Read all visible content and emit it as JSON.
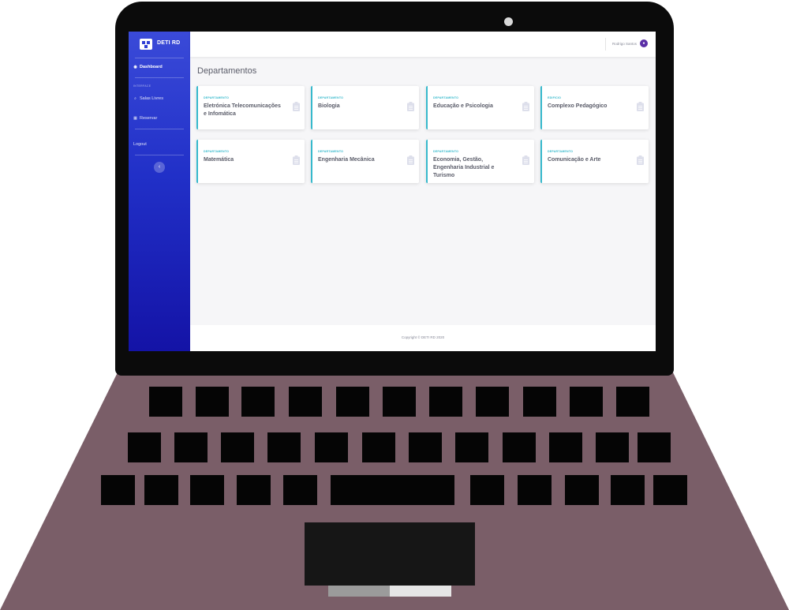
{
  "colors": {
    "sidebar_top": "#3a4ad8",
    "sidebar_bottom": "#1413a6",
    "card_accent": "#36b9cc",
    "laptop_body": "#7a5e68"
  },
  "brand": {
    "name": "DETI RD"
  },
  "sidebar": {
    "dashboard_label": "Dashboard",
    "section_heading": "INTERFACE",
    "items": [
      {
        "label": "Salas Livres",
        "icon": "search-icon"
      },
      {
        "label": "Reservar",
        "icon": "calendar-icon"
      }
    ],
    "logout_label": "Logout",
    "collapse_glyph": "‹"
  },
  "topbar": {
    "user_name": "Rodrigo Santos",
    "avatar_glyph": "●"
  },
  "main": {
    "title": "Departamentos",
    "cards": [
      {
        "label": "DEPARTAMENTO",
        "title": "Eletrónica Telecomunicações e Infomática"
      },
      {
        "label": "DEPARTAMENTO",
        "title": "Biologia"
      },
      {
        "label": "DEPARTAMENTO",
        "title": "Educação e Psicologia"
      },
      {
        "label": "EDIFICIO",
        "title": "Complexo Pedagógico"
      },
      {
        "label": "DEPARTAMENTO",
        "title": "Matemática"
      },
      {
        "label": "DEPARTAMENTO",
        "title": "Engenharia Mecânica"
      },
      {
        "label": "DEPARTAMENTO",
        "title": "Economia, Gestão, Engenharia Industrial e Turismo"
      },
      {
        "label": "DEPARTAMENTO",
        "title": "Comunicação e Arte"
      }
    ]
  },
  "footer": {
    "copyright": "Copyright © DETI RD 2020"
  }
}
